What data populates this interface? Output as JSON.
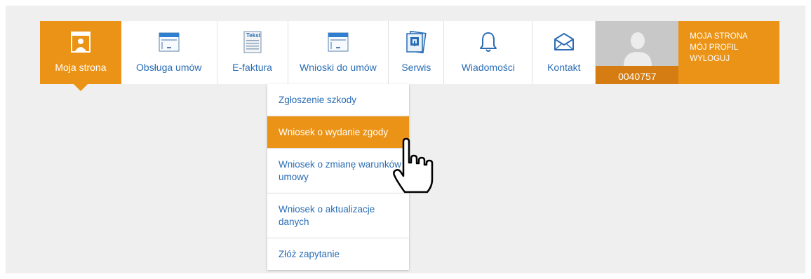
{
  "nav": {
    "items": [
      {
        "label": "Moja strona",
        "icon": "moja-strona-icon",
        "active": true
      },
      {
        "label": "Obsługa umów",
        "icon": "document-form-icon"
      },
      {
        "label": "E-faktura",
        "icon": "text-document-icon",
        "icon_text": "Tekst"
      },
      {
        "label": "Wnioski do umów",
        "icon": "document-form-icon"
      },
      {
        "label": "Serwis",
        "icon": "service-icon"
      },
      {
        "label": "Wiadomości",
        "icon": "bell-icon"
      },
      {
        "label": "Kontakt",
        "icon": "envelope-icon"
      }
    ],
    "user_id": "0040757",
    "user_menu": [
      "MOJA STRONA",
      "MÓJ PROFIL",
      "WYLOGUJ"
    ]
  },
  "dropdown": {
    "items": [
      {
        "label": "Zgłoszenie szkody"
      },
      {
        "label": "Wniosek o wydanie zgody",
        "active": true
      },
      {
        "label": "Wniosek o zmianę warunków umowy"
      },
      {
        "label": "Wniosek o aktualizacje danych"
      },
      {
        "label": "Złóż zapytanie"
      }
    ]
  },
  "colors": {
    "accent": "#eb9316",
    "accent_dark": "#d57d12",
    "link": "#2a6db5",
    "background": "#efefef"
  }
}
